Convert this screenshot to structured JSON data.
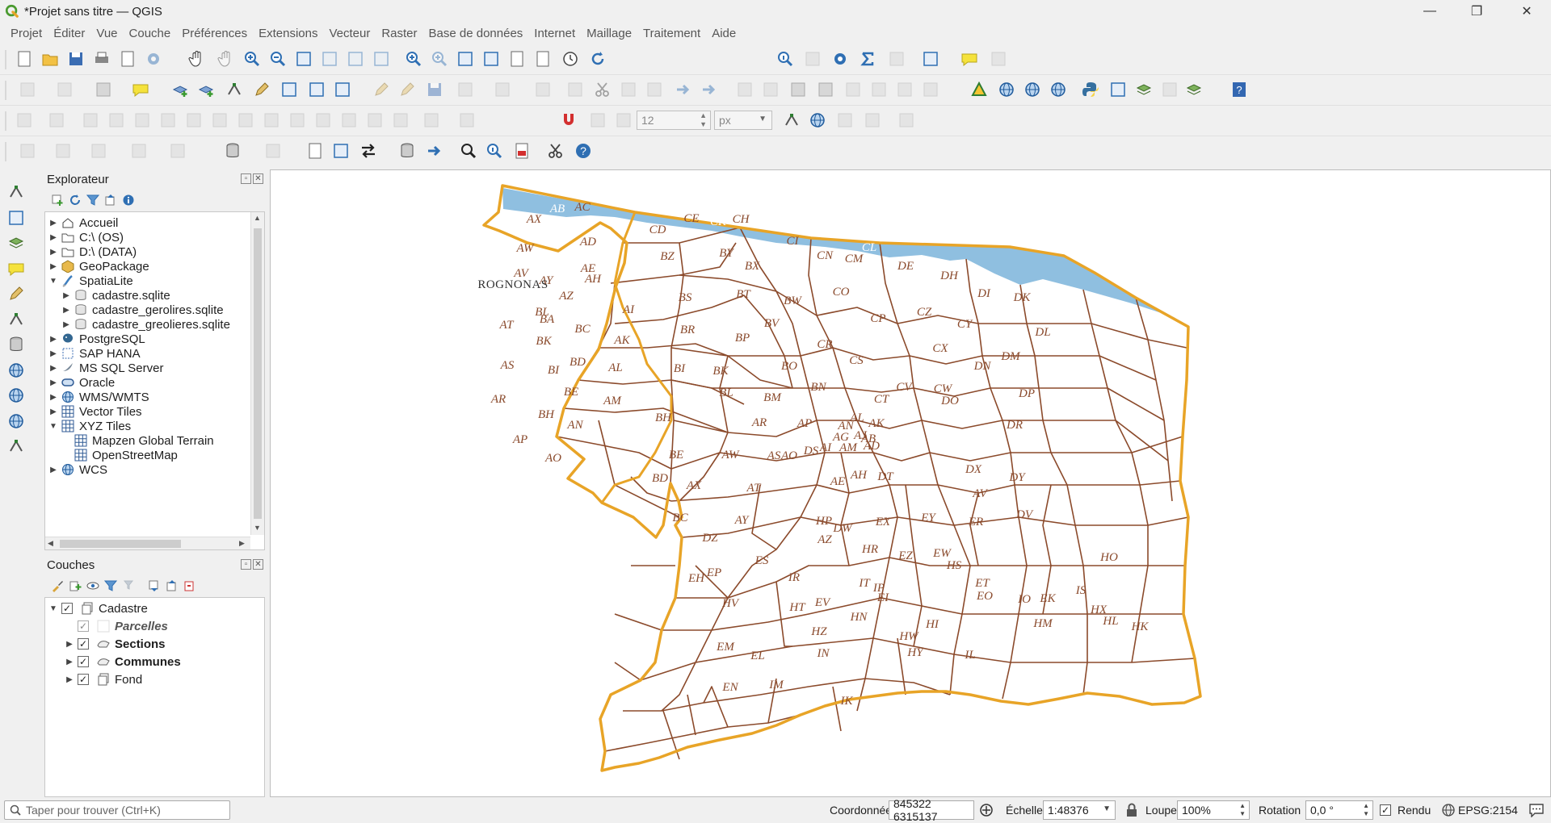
{
  "window": {
    "title": "*Projet sans titre — QGIS"
  },
  "menu": [
    "Projet",
    "Éditer",
    "Vue",
    "Couche",
    "Préférences",
    "Extensions",
    "Vecteur",
    "Raster",
    "Base de données",
    "Internet",
    "Maillage",
    "Traitement",
    "Aide"
  ],
  "toolbar": {
    "font_size_value": "12",
    "unit_value": "px"
  },
  "explorer": {
    "title": "Explorateur",
    "items": [
      {
        "label": "Accueil",
        "icon": "home-icon",
        "expanded": false
      },
      {
        "label": "C:\\ (OS)",
        "icon": "folder-icon",
        "expanded": false
      },
      {
        "label": "D:\\ (DATA)",
        "icon": "folder-icon",
        "expanded": false
      },
      {
        "label": "GeoPackage",
        "icon": "geopackage-icon",
        "expanded": false
      },
      {
        "label": "SpatiaLite",
        "icon": "spatialite-icon",
        "expanded": true
      },
      {
        "label": "cadastre.sqlite",
        "icon": "database-icon",
        "child": true
      },
      {
        "label": "cadastre_gerolires.sqlite",
        "icon": "database-icon",
        "child": true
      },
      {
        "label": "cadastre_greolieres.sqlite",
        "icon": "database-icon",
        "child": true
      },
      {
        "label": "PostgreSQL",
        "icon": "postgresql-icon",
        "expanded": false
      },
      {
        "label": "SAP HANA",
        "icon": "sap-hana-icon",
        "expanded": false
      },
      {
        "label": "MS SQL Server",
        "icon": "mssql-icon",
        "expanded": false
      },
      {
        "label": "Oracle",
        "icon": "oracle-icon",
        "expanded": false
      },
      {
        "label": "WMS/WMTS",
        "icon": "globe-icon",
        "expanded": false
      },
      {
        "label": "Vector Tiles",
        "icon": "grid-icon",
        "expanded": false
      },
      {
        "label": "XYZ Tiles",
        "icon": "grid-icon",
        "expanded": true
      },
      {
        "label": "Mapzen Global Terrain",
        "icon": "grid-icon",
        "child": true
      },
      {
        "label": "OpenStreetMap",
        "icon": "grid-icon",
        "child": true
      },
      {
        "label": "WCS",
        "icon": "globe-icon",
        "expanded": false
      }
    ]
  },
  "layers": {
    "title": "Couches",
    "items": [
      {
        "label": "Cadastre",
        "level": 0,
        "checked": true,
        "bold": false,
        "italic": false,
        "expanded": true,
        "icon": "group-icon"
      },
      {
        "label": "Parcelles",
        "level": 1,
        "checked": true,
        "bold": true,
        "italic": true,
        "expanded": false,
        "icon": "empty-symbol-icon"
      },
      {
        "label": "Sections",
        "level": 1,
        "checked": true,
        "bold": true,
        "italic": false,
        "expanded": false,
        "icon": "polygon-layer-icon"
      },
      {
        "label": "Communes",
        "level": 1,
        "checked": true,
        "bold": true,
        "italic": false,
        "expanded": false,
        "icon": "polygon-layer-icon"
      },
      {
        "label": "Fond",
        "level": 1,
        "checked": true,
        "bold": false,
        "italic": false,
        "expanded": false,
        "icon": "group-icon"
      }
    ]
  },
  "map": {
    "commune_label": "ROGNONAS",
    "river_labels": [
      "AA",
      "AB",
      "CK",
      "CL"
    ],
    "section_labels": [
      "AX",
      "AC",
      "AD",
      "AW",
      "AE",
      "AV",
      "AY",
      "AH",
      "AZ",
      "BL",
      "BA",
      "AI",
      "AT",
      "BC",
      "AK",
      "BK",
      "BD",
      "AL",
      "AS",
      "BI",
      "BE",
      "AM",
      "AR",
      "BH",
      "AN",
      "AP",
      "AO",
      "CD",
      "CE",
      "CH",
      "BZ",
      "BY",
      "CI",
      "CN",
      "CM",
      "DE",
      "DH",
      "DI",
      "DK",
      "BX",
      "BS",
      "BT",
      "CO",
      "BW",
      "CP",
      "CZ",
      "CY",
      "DL",
      "BR",
      "BP",
      "BV",
      "CR",
      "CX",
      "DM",
      "BI",
      "BK",
      "BO",
      "CS",
      "CV",
      "CW",
      "DN",
      "BL",
      "BN",
      "CT",
      "DO",
      "DP",
      "BM",
      "AL",
      "AK",
      "AJ",
      "AG",
      "AB",
      "DR",
      "BH",
      "AR",
      "AP",
      "AN",
      "AM",
      "AI",
      "DS",
      "BE",
      "AW",
      "AS",
      "AO",
      "AD",
      "DT",
      "DX",
      "DY",
      "BD",
      "AX",
      "AT",
      "AH",
      "AE",
      "AV",
      "EY",
      "DW",
      "BC",
      "AY",
      "HP",
      "EX",
      "ER",
      "DV",
      "DZ",
      "AZ",
      "HR",
      "EZ",
      "EW",
      "ES",
      "EP",
      "IR",
      "IT",
      "HS",
      "HO",
      "EH",
      "IP",
      "EV",
      "EI",
      "ET",
      "EO",
      "EK",
      "IS",
      "HV",
      "HT",
      "HN",
      "HI",
      "IO",
      "HX",
      "EM",
      "EL",
      "IN",
      "HZ",
      "HW",
      "HM",
      "HL",
      "HK",
      "EN",
      "IM",
      "IK",
      "HY",
      "IL"
    ]
  },
  "status": {
    "locator_placeholder": "Taper pour trouver (Ctrl+K)",
    "coord_label": "Coordonnée",
    "coord_value": "845322 6315137",
    "scale_label": "Échelle",
    "scale_value": "1:48376",
    "magnifier_label": "Loupe",
    "magnifier_value": "100%",
    "rotation_label": "Rotation",
    "rotation_value": "0,0 °",
    "render_label": "Rendu",
    "crs_label": "EPSG:2154"
  }
}
